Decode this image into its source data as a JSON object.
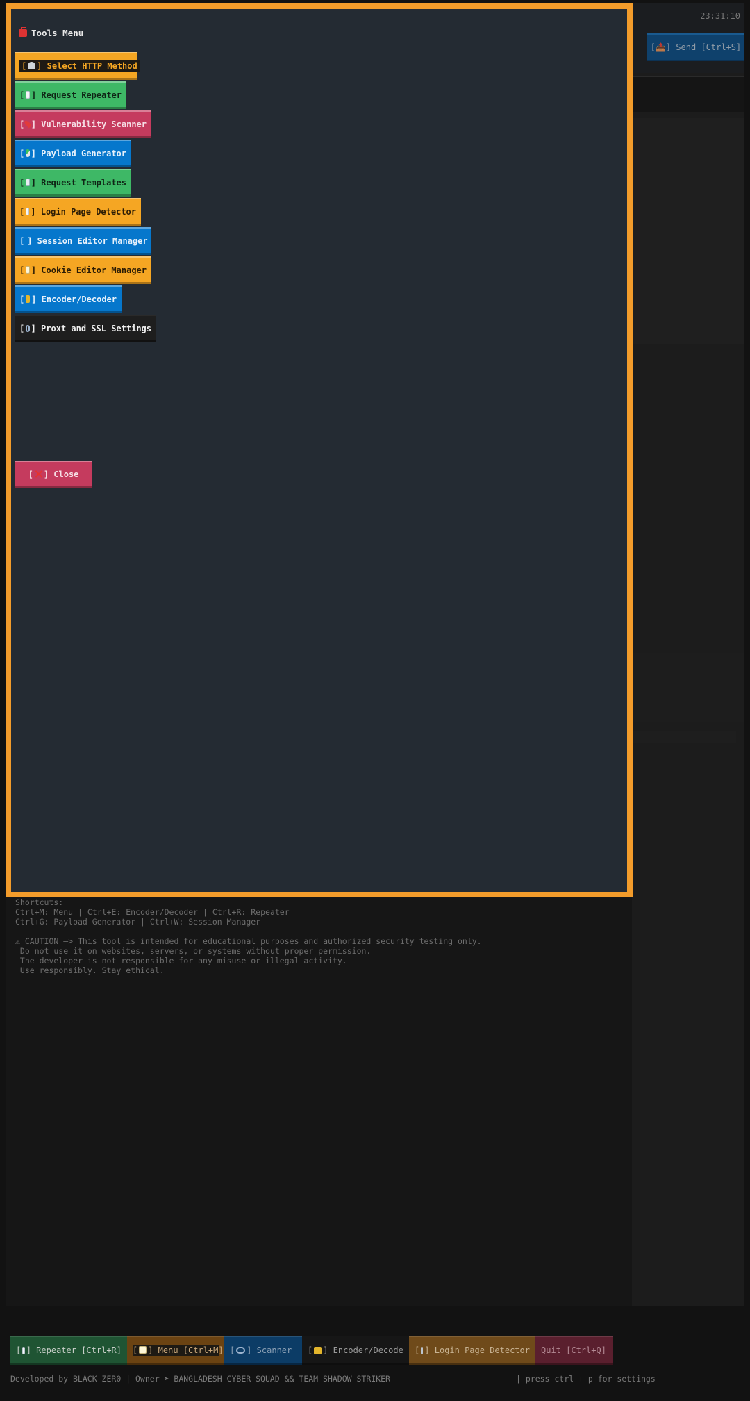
{
  "header": {
    "clock": "23:31:10",
    "send_label": "[📤] Send [Ctrl+S]"
  },
  "modal": {
    "title": "Tools Menu",
    "items": [
      {
        "open": "[",
        "close": "] Select HTTP Method",
        "icon": "satellite-antenna-icon"
      },
      {
        "open": "[",
        "close": "] Request Repeater",
        "icon": "document-icon"
      },
      {
        "open": "[",
        "close": "] Vulnerability Scanner",
        "icon": "pushpin-icon"
      },
      {
        "open": "[",
        "close": "] Payload Generator",
        "icon": "pill-icon"
      },
      {
        "open": "[",
        "close": "] Request Templates",
        "icon": "envelope-icon"
      },
      {
        "open": "[",
        "close": "] Login Page Detector",
        "icon": "document-icon"
      },
      {
        "open": "[",
        "close": "] Session Editor Manager",
        "icon": "pencil-icon"
      },
      {
        "open": "[",
        "close": "] Cookie Editor Manager",
        "icon": "memo-icon"
      },
      {
        "open": "[",
        "close": "] Encoder/Decoder",
        "icon": "lock-icon"
      },
      {
        "open": "[",
        "close": "] Proxt and SSL Settings",
        "icon": "link-icon"
      }
    ],
    "close_open": "[",
    "close_label": "] Close",
    "close_icon": "cross-mark-icon"
  },
  "info": {
    "shortcuts_title": "Shortcuts:",
    "shortcuts_line1": "Ctrl+M: Menu | Ctrl+E: Encoder/Decoder | Ctrl+R: Repeater",
    "shortcuts_line2": "Ctrl+G: Payload Generator | Ctrl+W: Session Manager",
    "caution_line1": "⚠ CAUTION —> This tool is intended for educational purposes and authorized security testing only.",
    "caution_line2": " Do not use it on websites, servers, or systems without proper permission.",
    "caution_line3": " The developer is not responsible for any misuse or illegal activity.",
    "caution_line4": " Use responsibly. Stay ethical."
  },
  "tabs": {
    "repeater": "] Repeater [Ctrl+R]",
    "menu": "] Menu [Ctrl+M]",
    "scanner": "] Scanner",
    "encoder": "] Encoder/Decode",
    "login": "] Login Page Detector",
    "quit": "Quit [Ctrl+Q]",
    "open": "["
  },
  "footer": {
    "credit": "Developed by BLACK ZER0 | Owner ➤ BANGLADESH CYBER SQUAD && TEAM SHADOW STRIKER",
    "hint": "| press ctrl + p for settings"
  }
}
